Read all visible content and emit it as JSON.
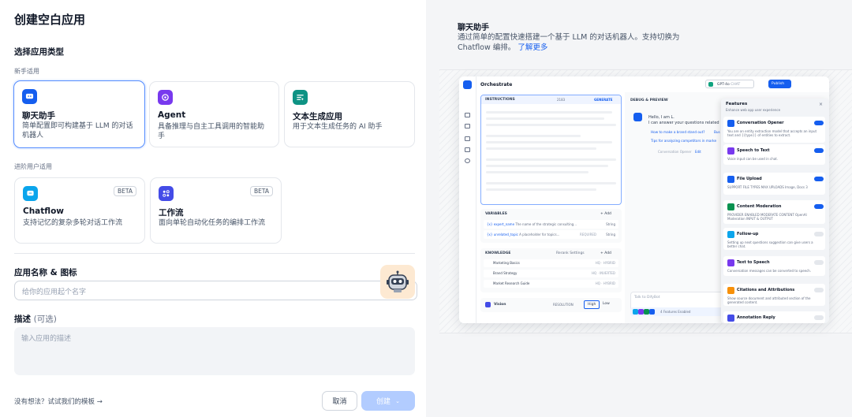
{
  "page": {
    "title": "创建空白应用"
  },
  "left": {
    "app_type_label": "选择应用类型",
    "beginner_label": "新手适用",
    "advanced_label": "进阶用户适用",
    "cards": [
      {
        "name": "聊天助手",
        "desc": "简单配置即可构建基于 LLM 的对话机器人",
        "icon": "chat-bubble-icon",
        "color": "#155eef"
      },
      {
        "name": "Agent",
        "desc": "具备推理与自主工具调用的智能助手",
        "icon": "agent-icon",
        "color": "#7839ee"
      },
      {
        "name": "文本生成应用",
        "desc": "用于文本生成任务的 AI 助手",
        "icon": "text-gen-icon",
        "color": "#0e9384"
      },
      {
        "name": "Chatflow",
        "desc": "支持记忆的复杂多轮对话工作流",
        "icon": "chatflow-icon",
        "color": "#0ba5ec",
        "badge": "BETA"
      },
      {
        "name": "工作流",
        "desc": "面向单轮自动化任务的编排工作流",
        "icon": "workflow-icon",
        "color": "#444ce7",
        "badge": "BETA"
      }
    ],
    "name_icon_label": "应用名称 & 图标",
    "name_placeholder": "给你的应用起个名字",
    "desc_label": "描述",
    "desc_optional": "(可选)",
    "desc_placeholder": "输入应用的描述",
    "template_link": "没有想法？试试我们的模板 →",
    "cancel": "取消",
    "create": "创建"
  },
  "preview": {
    "title": "聊天助手",
    "desc": "通过简单的配置快速搭建一个基于 LLM 的对话机器人。支持切换为 Chatflow 编排。",
    "learn_more": "了解更多",
    "mock": {
      "orchestrate": "Orchestrate",
      "model": "GPT-4o",
      "chat_tag": "CHAT",
      "publish": "Publish",
      "instructions": "INSTRUCTIONS",
      "count": "2183",
      "generate": "GENERATE",
      "debug": "DEBUG & PREVIEW",
      "greeting1": "Hello, I am L.",
      "greeting2": "I can answer your questions related",
      "q1": "How to make a brand stand out?",
      "q1b": "Bus",
      "q2": "Tips for analyzing competitors in marke",
      "opener": "Conversation Opener",
      "edit": "Edit",
      "variables": "VARIABLES",
      "add": "+ Add",
      "vars": [
        {
          "key": "{x} expert_name",
          "val": "The name of the strategic consulting...",
          "type": "String"
        },
        {
          "key": "{x} unrelated_topic",
          "val": "A placeholder for topics...",
          "req": "REQUIRED",
          "type": "String"
        }
      ],
      "knowledge": "KNOWLEDGE",
      "rerank": "Rerank Settings",
      "docs": [
        {
          "name": "Marketing Basics",
          "tag": "HQ · HYBRID"
        },
        {
          "name": "Brand Strategy",
          "tag": "HQ · INVERTED"
        },
        {
          "name": "Market Research Guide",
          "tag": "HQ · HYBRID"
        }
      ],
      "vision": "Vision",
      "resolution": "RESOLUTION",
      "high": "High",
      "low": "Low",
      "talk": "Talk to DifyBot",
      "features_enabled": "4 Features Enabled",
      "features_title": "Features",
      "features_sub": "Enhance web app user experience",
      "features": [
        {
          "name": "Conversation Opener",
          "desc": "You are an entity extraction model that accepts an input text and {{type}} of entities to extract.",
          "color": "#155eef",
          "on": true
        },
        {
          "name": "Speech to Text",
          "desc": "Voice input can be used in chat.",
          "color": "#7839ee",
          "on": true
        },
        {
          "name": "File Upload",
          "desc": "SUPPORT FILE TYPES  MAX UPLOADS  Image, Docs  3",
          "color": "#155eef",
          "on": true
        },
        {
          "name": "Content Moderation",
          "desc": "PROVIDER  ENABLED MODERATE CONTENT  OpenAI Moderation  INPUT & OUTPUT",
          "color": "#099250",
          "on": true
        },
        {
          "name": "Follow-up",
          "desc": "Setting up next questions suggestion can give users a better chat.",
          "color": "#0ba5ec",
          "on": false
        },
        {
          "name": "Text to Speech",
          "desc": "Conversation messages can be converted to speech.",
          "color": "#7839ee",
          "on": false
        },
        {
          "name": "Citations and Attributions",
          "desc": "Show source document and attributed section of the generated content.",
          "color": "#f79009",
          "on": false
        },
        {
          "name": "Annotation Reply",
          "desc": "",
          "color": "#444ce7",
          "on": false
        }
      ]
    }
  }
}
